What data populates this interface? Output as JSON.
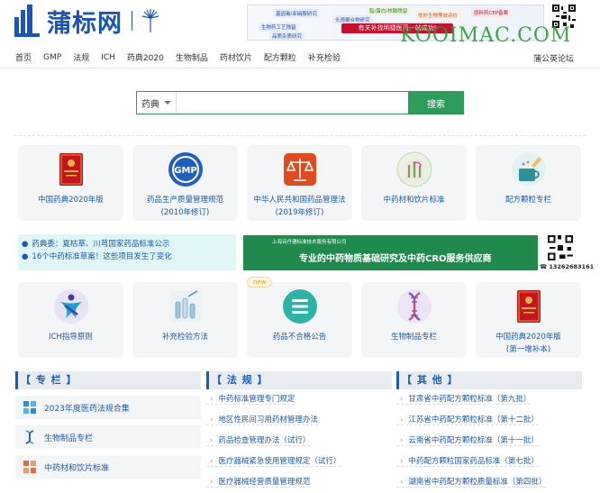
{
  "header": {
    "logo_text": "蒲标网",
    "ad": {
      "tags": [
        "基因毒/亚硝胺研究",
        "脂/蛋白/核酸残留",
        "体外生物等效评价",
        "原料药CEP备案",
        "头孢聚合物研究",
        "生物药工艺残留",
        "有关补找明捷医药一站成功!",
        "品质杂质研究"
      ],
      "watermark": "KOOIMAC.COM"
    }
  },
  "nav": {
    "items": [
      "首页",
      "GMP",
      "法规",
      "ICH",
      "药典2020",
      "生物制品",
      "药材饮片",
      "配方颗粒",
      "补充检验"
    ],
    "forum": "蒲公英论坛"
  },
  "search": {
    "select": "药典",
    "placeholder": "",
    "button": "搜索"
  },
  "cards_row1": [
    {
      "label": "中国药典2020年版",
      "icon": "pharmacopoeia-book-icon"
    },
    {
      "label": "药品生产质量管理规范\n(2010年修订)",
      "icon": "gmp-badge-icon"
    },
    {
      "label": "中华人民共和国药品管理法\n(2019年修订)",
      "icon": "law-scale-icon"
    },
    {
      "label": "中药材和饮片标准",
      "icon": "herb-icon"
    },
    {
      "label": "配方颗粒专栏",
      "icon": "granule-cup-icon"
    }
  ],
  "notice": {
    "lines": [
      "药典委：夏枯草、川芎国家药品标准公示",
      "16个中药标准草案！这些项目发生了变化"
    ]
  },
  "banner2": {
    "small": "上海诗丹德标准技术服务有限公司",
    "big": "专业的中药物质基础研究及中药CRO服务供应商",
    "phone": "13262683161"
  },
  "cards_row2": [
    {
      "label": "ICH指导原则",
      "icon": "ich-logo-icon"
    },
    {
      "label": "补充检验方法",
      "icon": "test-tube-icon"
    },
    {
      "label": "药品不合格公告",
      "icon": "list-notice-icon",
      "badge": "new"
    },
    {
      "label": "生物制品专栏",
      "icon": "dna-icon"
    },
    {
      "label": "中国药典2020年版\n(第一增补本)",
      "icon": "pharmacopoeia-book-icon"
    }
  ],
  "columns": {
    "special": {
      "title": "【 专 栏 】",
      "topics": [
        "2023年度医药法规合集",
        "生物制品专栏",
        "中药材和饮片标准"
      ]
    },
    "laws": {
      "title": "【 法 规 】",
      "items": [
        "中药标准管理专门规定",
        "地区性民间习用药材管理办法",
        "药品检查管理办法（试行）",
        "医疗器械紧急使用管理规定（试行）",
        "医疗器械经营质量管理规范"
      ]
    },
    "others": {
      "title": "【 其 他 】",
      "items": [
        "甘肃省中药配方颗粒标准（第九批）",
        "江苏省中药配方颗粒标准（第十二批）",
        "云南省中药配方颗粒标准（第十一批）",
        "中药配方颗粒国家药品标准（第七批）",
        "湖南省中药配方颗粒质量标准（第四批）"
      ]
    }
  },
  "colors": {
    "brand": "#1a55b3",
    "green": "#2d9c5a",
    "link": "#1d5aa8"
  }
}
